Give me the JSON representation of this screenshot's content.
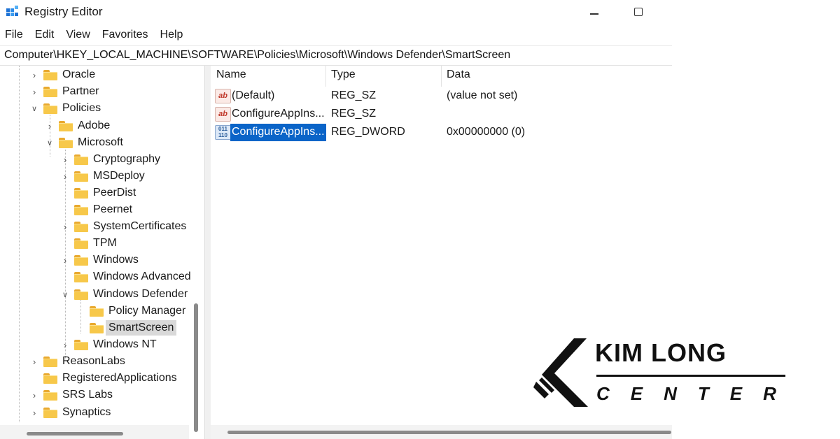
{
  "window": {
    "title": "Registry Editor",
    "icon": "registry-editor-icon"
  },
  "menu": [
    "File",
    "Edit",
    "View",
    "Favorites",
    "Help"
  ],
  "address": "Computer\\HKEY_LOCAL_MACHINE\\SOFTWARE\\Policies\\Microsoft\\Windows Defender\\SmartScreen",
  "tree": {
    "items": [
      {
        "label": "Oracle",
        "state": "collapsed"
      },
      {
        "label": "Partner",
        "state": "collapsed"
      },
      {
        "label": "Policies",
        "state": "expanded"
      },
      {
        "label": "Adobe",
        "state": "collapsed"
      },
      {
        "label": "Microsoft",
        "state": "expanded"
      },
      {
        "label": "Cryptography",
        "state": "collapsed"
      },
      {
        "label": "MSDeploy",
        "state": "collapsed"
      },
      {
        "label": "PeerDist",
        "state": "leaf"
      },
      {
        "label": "Peernet",
        "state": "leaf"
      },
      {
        "label": "SystemCertificates",
        "state": "collapsed"
      },
      {
        "label": "TPM",
        "state": "leaf"
      },
      {
        "label": "Windows",
        "state": "collapsed"
      },
      {
        "label": "Windows Advanced",
        "state": "leaf"
      },
      {
        "label": "Windows Defender",
        "state": "expanded"
      },
      {
        "label": "Policy Manager",
        "state": "leaf"
      },
      {
        "label": "SmartScreen",
        "state": "leaf",
        "selected": true
      },
      {
        "label": "Windows NT",
        "state": "collapsed"
      },
      {
        "label": "ReasonLabs",
        "state": "collapsed"
      },
      {
        "label": "RegisteredApplications",
        "state": "leaf"
      },
      {
        "label": "SRS Labs",
        "state": "collapsed"
      },
      {
        "label": "Synaptics",
        "state": "collapsed"
      }
    ]
  },
  "list": {
    "columns": {
      "name": "Name",
      "type": "Type",
      "data": "Data"
    },
    "rows": [
      {
        "name": "(Default)",
        "type": "REG_SZ",
        "data": "(value not set)",
        "icon": "string-value-icon"
      },
      {
        "name": "ConfigureAppIns...",
        "type": "REG_SZ",
        "data": "",
        "icon": "string-value-icon"
      },
      {
        "name": "ConfigureAppIns...",
        "type": "REG_DWORD",
        "data": "0x00000000 (0)",
        "icon": "dword-value-icon",
        "selected": true
      }
    ],
    "icon_text": {
      "sz": "ab",
      "dword": "011 110"
    }
  },
  "watermark": {
    "line1": "KIM LONG",
    "line2": "CENTER"
  },
  "colors": {
    "selection": "#0a64c8",
    "folder": "#f7c84a"
  }
}
